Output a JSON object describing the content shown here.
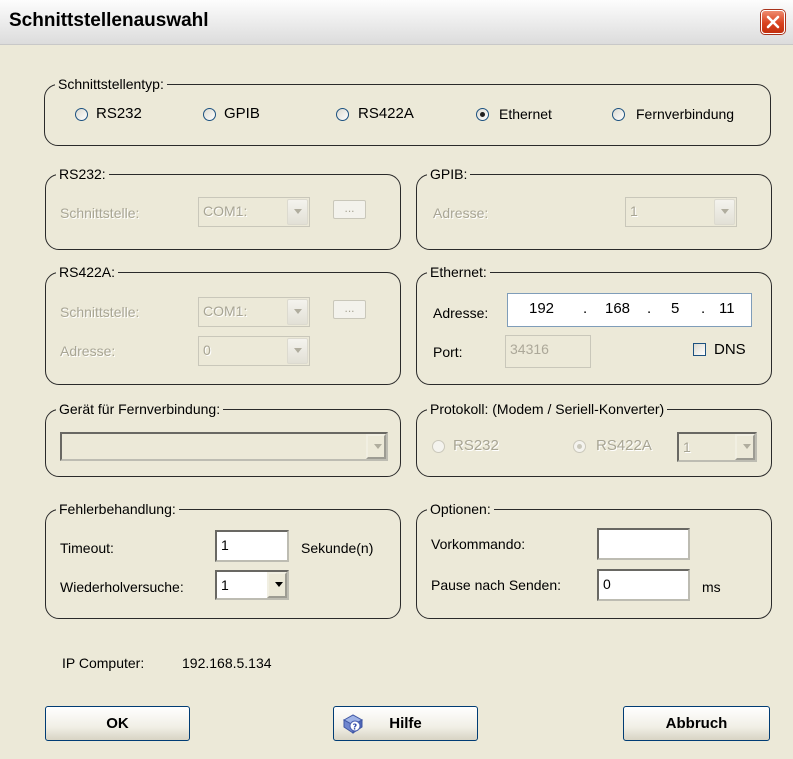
{
  "window": {
    "title": "Schnittstellenauswahl"
  },
  "interface_type": {
    "legend": "Schnittstellentyp:",
    "options": [
      "RS232",
      "GPIB",
      "RS422A",
      "Ethernet",
      "Fernverbindung"
    ],
    "selected": "Ethernet"
  },
  "rs232": {
    "legend": "RS232:",
    "port_label": "Schnittstelle:",
    "port_value": "COM1:",
    "browse_label": "..."
  },
  "gpib": {
    "legend": "GPIB:",
    "address_label": "Adresse:",
    "address_value": "1"
  },
  "rs422a": {
    "legend": "RS422A:",
    "port_label": "Schnittstelle:",
    "port_value": "COM1:",
    "browse_label": "...",
    "address_label": "Adresse:",
    "address_value": "0"
  },
  "ethernet": {
    "legend": "Ethernet:",
    "address_label": "Adresse:",
    "ip": [
      "192",
      "168",
      "5",
      "11"
    ],
    "ip_dot": ".",
    "port_label": "Port:",
    "port_value": "34316",
    "dns_label": "DNS"
  },
  "remote": {
    "legend": "Gerät für Fernverbindung:",
    "device_value": ""
  },
  "protocol": {
    "legend": "Protokoll: (Modem / Seriell-Konverter)",
    "options": [
      "RS232",
      "RS422A"
    ],
    "selected": "RS422A",
    "address_value": "1"
  },
  "error_handling": {
    "legend": "Fehlerbehandlung:",
    "timeout_label": "Timeout:",
    "timeout_value": "1",
    "timeout_unit": "Sekunde(n)",
    "retry_label": "Wiederholversuche:",
    "retry_value": "1"
  },
  "options": {
    "legend": "Optionen:",
    "precommand_label": "Vorkommando:",
    "precommand_value": "",
    "pause_label": "Pause nach Senden:",
    "pause_value": "0",
    "pause_unit": "ms"
  },
  "status": {
    "ip_label": "IP Computer:",
    "ip_value": "192.168.5.134"
  },
  "buttons": {
    "ok": "OK",
    "help": "Hilfe",
    "cancel": "Abbruch"
  },
  "colors": {
    "background": "#ece9d8",
    "close_button": "#d9431f",
    "disabled_text": "#a8a594",
    "field_border": "#7f9db9"
  }
}
